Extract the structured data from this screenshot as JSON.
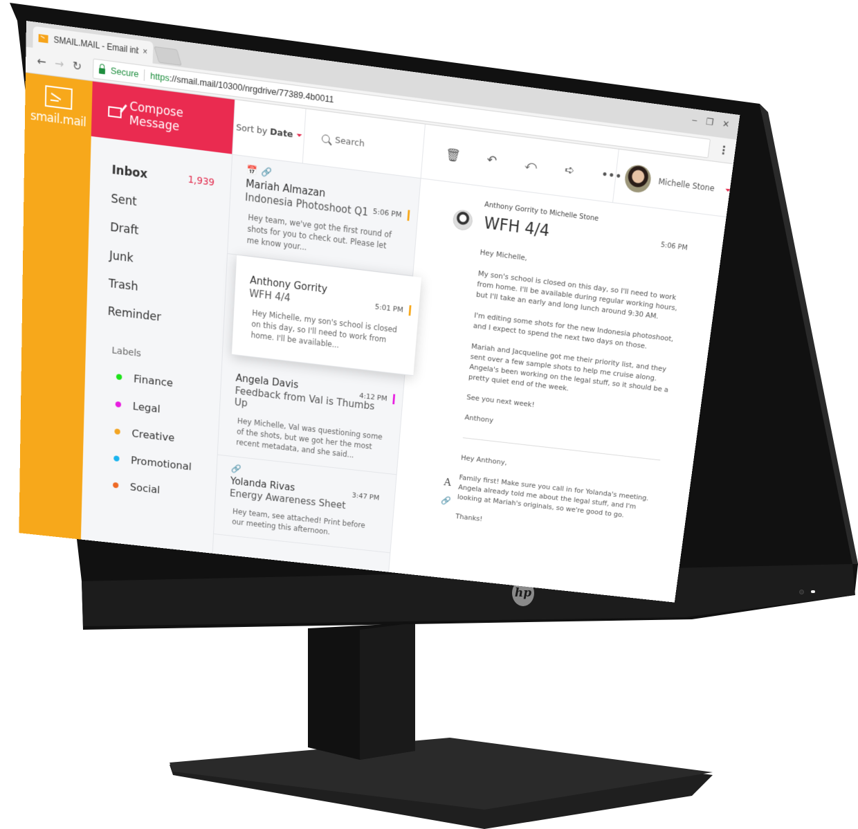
{
  "browser": {
    "tab_title": "SMAIL.MAIL - Email inbox",
    "tab_close": "×",
    "window_controls": [
      "–",
      "❐",
      "✕"
    ],
    "nav": {
      "back": "←",
      "forward": "→",
      "reload": "↻"
    },
    "secure_label": "Secure",
    "url_scheme": "https",
    "url_rest": "://smail.mail/10300/nrgdrive/77389.4b0011",
    "menu_icon": "⋮"
  },
  "app": {
    "brand_name": "smail.mail",
    "compose_label": "Compose Message",
    "sort": {
      "prefix": "Sort by",
      "value": "Date"
    },
    "search_placeholder": "Search",
    "folders": [
      {
        "label": "Inbox",
        "count": "1,939",
        "active": true
      },
      {
        "label": "Sent",
        "count": ""
      },
      {
        "label": "Draft",
        "count": ""
      },
      {
        "label": "Junk",
        "count": ""
      },
      {
        "label": "Trash",
        "count": ""
      },
      {
        "label": "Reminder",
        "count": ""
      }
    ],
    "labels_title": "Labels",
    "labels": [
      {
        "name": "Finance",
        "color": "#1ee31a"
      },
      {
        "name": "Legal",
        "color": "#e81ee0"
      },
      {
        "name": "Creative",
        "color": "#f3a523"
      },
      {
        "name": "Promotional",
        "color": "#1ab4ef"
      },
      {
        "name": "Social",
        "color": "#ee6a26"
      }
    ],
    "messages": [
      {
        "from": "Mariah Almazan",
        "subject": "Indonesia Photoshoot Q1",
        "time": "5:06 PM",
        "flag_color": "#f7a81b",
        "icons": [
          "📅",
          "🔗"
        ],
        "preview": "Hey team, we've got the first round of shots for you to check out. Please let me know your..."
      },
      {
        "from": "Anthony Gorrity",
        "subject": "WFH 4/4",
        "time": "5:01 PM",
        "flag_color": "#f7a81b",
        "selected": true,
        "icons": [],
        "preview": "Hey Michelle, my son's school is closed on this day, so I'll need to work from home. I'll be available..."
      },
      {
        "from": "Angela Davis",
        "subject": "Feedback from Val is Thumbs Up",
        "time": "4:12 PM",
        "flag_color": "#e81ee0",
        "icons": [],
        "preview": "Hey Michelle, Val was questioning some of the shots, but we got her the most recent metadata, and she said..."
      },
      {
        "from": "Yolanda Rivas",
        "subject": "Energy Awareness Sheet",
        "time": "3:47 PM",
        "flag_color": "",
        "icons": [
          "🔗"
        ],
        "preview": "Hey team, see attached! Print before our meeting this afternoon."
      }
    ],
    "toolbar": {
      "delete": "🗑",
      "reply": "↶",
      "reply_all": "⤺",
      "forward": "➪",
      "more": "•••"
    },
    "user_name": "Michelle Stone",
    "thread": {
      "meta": "Anthony Gorrity to Michelle Stone",
      "title": "WFH 4/4",
      "time": "5:06 PM",
      "body": [
        "Hey Michelle,",
        "My son's school is closed on this day, so I'll need to work from home. I'll be available during regular working hours, but I'll take an early and long lunch around 9:30 AM.",
        "I'm editing some shots for the new Indonesia photoshoot, and I expect to spend the next two days on those.",
        "Mariah and Jacqueline got me their priority list, and they sent over a few sample shots to help me cruise along. Angela's been working on the legal stuff, so it should be a pretty quiet end of the week.",
        "See you next week!",
        "Anthony"
      ],
      "reply": [
        "Hey Anthony,",
        "Family first! Make sure you call in for Yolanda's meeting. Angela already told me about the legal stuff, and I'm looking at Mariah's originals, so we're good to go.",
        "Thanks!"
      ],
      "reply_font_icon": "A",
      "reply_link_icon": "🔗"
    }
  },
  "hardware": {
    "brand_logo": "hp"
  }
}
